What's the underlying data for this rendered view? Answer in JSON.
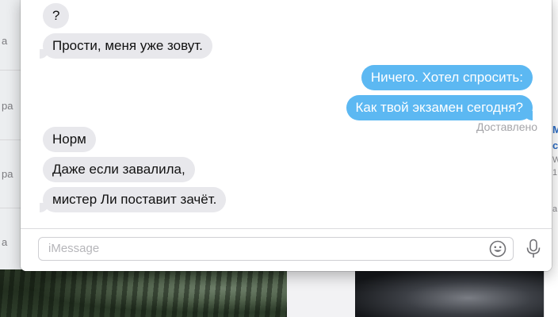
{
  "background": {
    "left_fragments": [
      "а",
      "ра",
      "ра",
      "а"
    ],
    "right_fragments": [
      "М",
      "с",
      "W",
      "1",
      "а"
    ]
  },
  "messages": [
    {
      "direction": "incoming",
      "text": "?"
    },
    {
      "direction": "incoming",
      "text": "Прости, меня уже зовут."
    },
    {
      "direction": "outgoing",
      "text": "Ничего. Хотел спросить:"
    },
    {
      "direction": "outgoing",
      "text": "Как твой экзамен сегодня?"
    },
    {
      "direction": "incoming",
      "text": "Норм"
    },
    {
      "direction": "incoming",
      "text": "Даже если завалила,"
    },
    {
      "direction": "incoming",
      "text": "мистер Ли поставит зачёт."
    }
  ],
  "status": {
    "delivered": "Доставлено"
  },
  "composer": {
    "placeholder": "iMessage",
    "emoji_icon": "emoji-smile-icon",
    "mic_icon": "microphone-icon"
  },
  "colors": {
    "outgoing_bubble": "#5cb8f2",
    "incoming_bubble": "#e8e8ec",
    "delivered_text": "#a4a4a8"
  }
}
